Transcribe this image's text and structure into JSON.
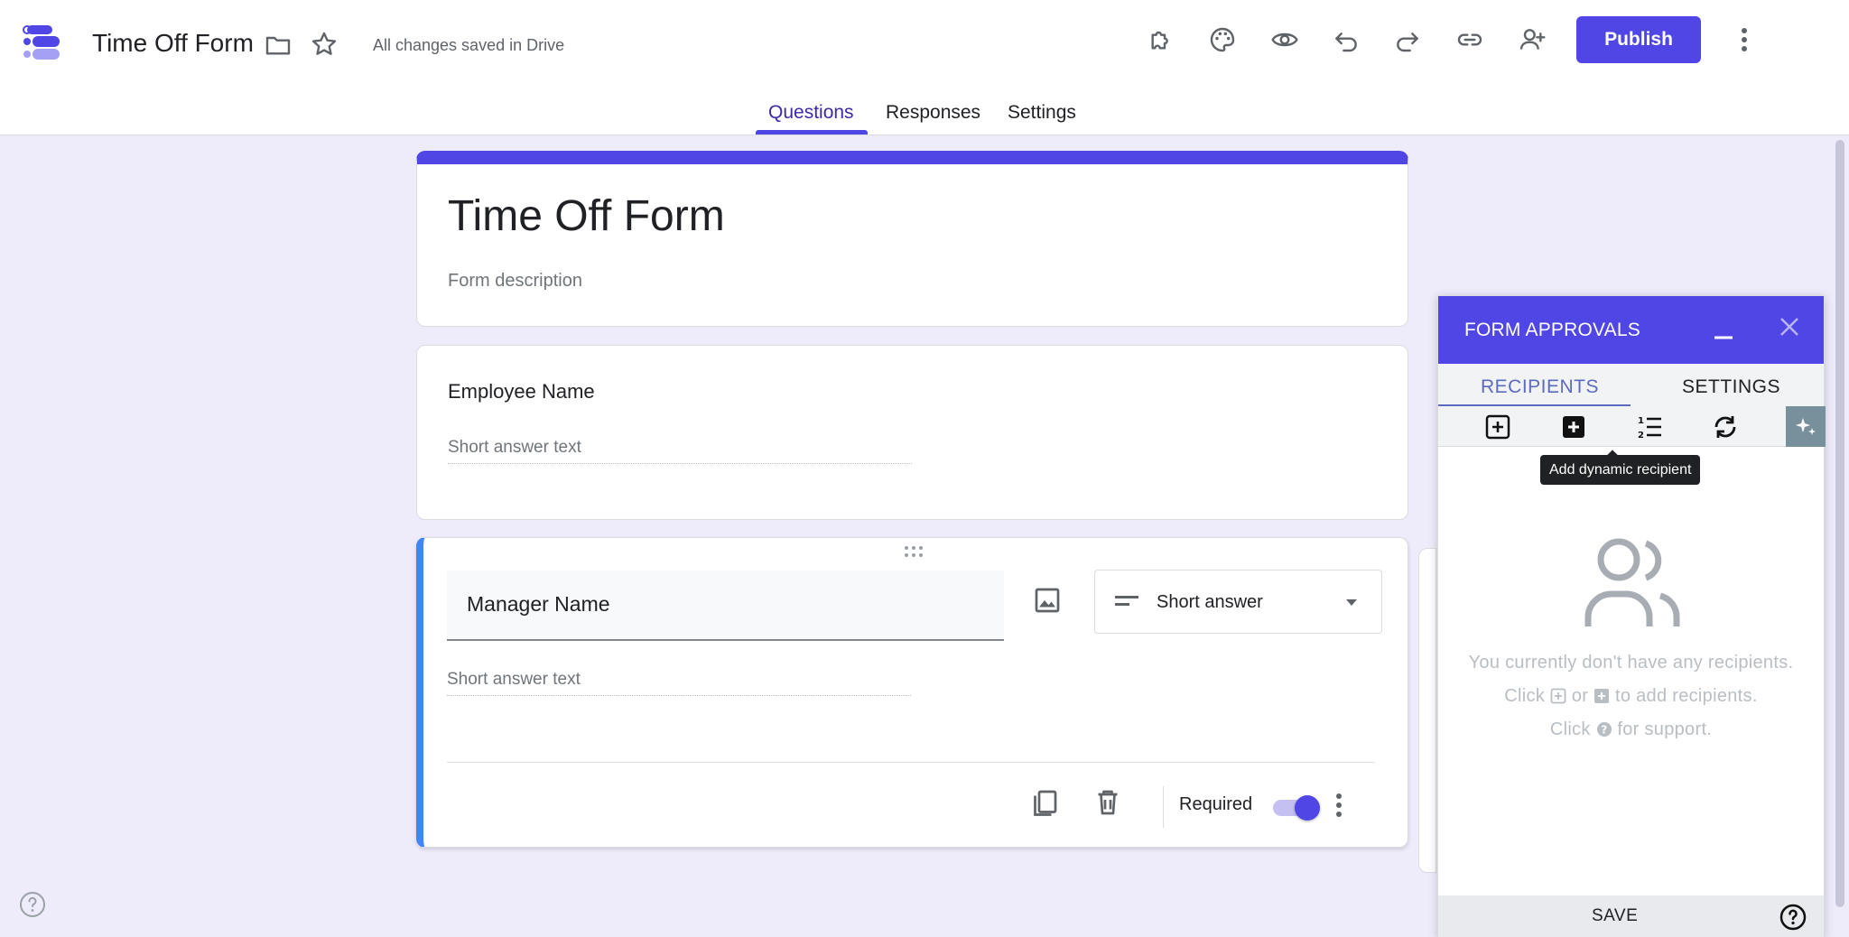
{
  "header": {
    "doc_title": "Time Off Form",
    "saved_status": "All changes saved in Drive",
    "publish_label": "Publish",
    "icons": [
      "folder-icon",
      "star-icon",
      "puzzle-icon",
      "palette-icon",
      "eye-icon",
      "undo-icon",
      "redo-icon",
      "link-icon",
      "add-person-icon",
      "more-vert-icon"
    ]
  },
  "tabs": [
    {
      "label": "Questions",
      "active": true
    },
    {
      "label": "Responses",
      "active": false
    },
    {
      "label": "Settings",
      "active": false
    }
  ],
  "form": {
    "title": "Time Off Form",
    "description_placeholder": "Form description"
  },
  "questions": [
    {
      "title": "Employee Name",
      "answer_placeholder": "Short answer text"
    },
    {
      "title": "Manager Name",
      "answer_placeholder": "Short answer text",
      "type": "Short answer",
      "required_label": "Required",
      "required": true
    }
  ],
  "approvals_panel": {
    "title": "FORM APPROVALS",
    "tabs": [
      "RECIPIENTS",
      "SETTINGS"
    ],
    "tooltip": "Add dynamic recipient",
    "empty_line1": "You currently don't have any recipients.",
    "empty_line2_a": "Click",
    "empty_line2_b": "or",
    "empty_line2_c": "to add recipients.",
    "empty_line3_a": "Click",
    "empty_line3_b": "for support.",
    "save_label": "SAVE"
  },
  "colors": {
    "accent": "#4f46e5",
    "background": "#eeecfa",
    "question_highlight": "#4285f4"
  }
}
